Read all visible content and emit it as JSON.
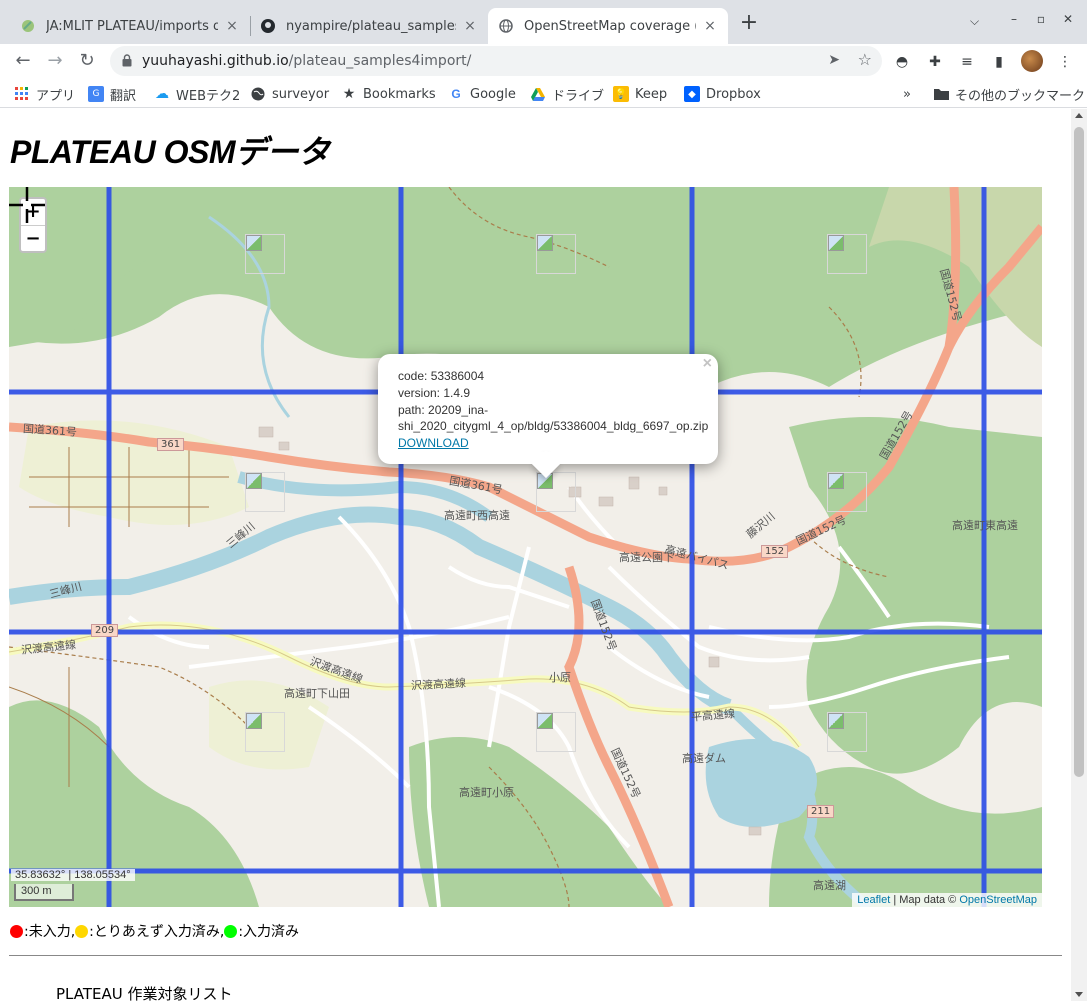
{
  "tabs": [
    {
      "title": "JA:MLIT PLATEAU/imports out",
      "icon": "osm-wiki-icon"
    },
    {
      "title": "nyampire/plateau_samples4im",
      "icon": "github-icon"
    },
    {
      "title": "OpenStreetMap coverage (am",
      "icon": "globe-icon"
    }
  ],
  "address": {
    "host": "yuuhayashi.github.io",
    "path": "/plateau_samples4import/"
  },
  "bookmarks": [
    {
      "label": "アプリ",
      "icon": "apps-grid-icon"
    },
    {
      "label": "翻訳",
      "icon": "translate-icon"
    },
    {
      "label": "WEBテク2",
      "icon": "cloud-icon"
    },
    {
      "label": "surveyor",
      "icon": "globe-icon"
    },
    {
      "label": "Bookmarks",
      "icon": "star-icon"
    },
    {
      "label": "Google",
      "icon": "google-icon"
    },
    {
      "label": "ドライブ",
      "icon": "drive-icon"
    },
    {
      "label": "Keep",
      "icon": "keep-icon"
    },
    {
      "label": "Dropbox",
      "icon": "dropbox-icon"
    }
  ],
  "bookmarks_more": "»",
  "other_bookmarks": "その他のブックマーク",
  "page": {
    "title": "PLATEAU OSMデータ",
    "zoom_in": "+",
    "zoom_out": "−",
    "popup": {
      "code": "code: 53386004",
      "version": "version: 1.4.9",
      "path1": "path: 20209_ina-",
      "path2": "shi_2020_citygml_4_op/bldg/53386004_bldg_6697_op.zip",
      "link": "DOWNLOAD",
      "close": "×"
    },
    "coords": "35.83632° | 138.05534°",
    "scale": "300 m",
    "attribution": {
      "leaflet": "Leaflet",
      "sep": " | Map data © ",
      "osm": "OpenStreetMap"
    },
    "map_labels": {
      "r361_a": "国道361号",
      "r361_b": "国道361号",
      "r152_a": "国道152号",
      "r152_b": "国道152号",
      "r152_c": "国道152号",
      "r152_d": "国道152号",
      "r152_e": "国道152号",
      "nishi": "高遠町西高遠",
      "higashi": "高遠町東高遠",
      "shimoyamada": "高遠町下山田",
      "obara_town": "高遠町小原",
      "obara": "小原",
      "sawatari": "沢渡高遠線",
      "sawatari2": "沢渡高遠線",
      "sawatari3": "沢渡高遠線",
      "bypass": "高遠公園下",
      "bypass2": "高遠バイパス",
      "dam": "高遠ダム",
      "ko": "高遠湖",
      "fujisawa": "藤沢川",
      "mibu": "三峰川",
      "mibu2": "三峰川",
      "heiko": "平高遠線",
      "shield361": "361",
      "shield152": "152",
      "shield211": "211",
      "shield209": "209"
    },
    "legend": [
      {
        "color": "#ff0000",
        "label": ":未入力, "
      },
      {
        "color": "#ffd700",
        "label": ":とりあえず入力済み, "
      },
      {
        "color": "#00ff00",
        "label": ":入力済み"
      }
    ],
    "list_heading": "PLATEAU 作業対象リスト"
  },
  "colors": {
    "grid": "#2e4fe6",
    "road_primary": "#f4a68a",
    "forest": "#add19e",
    "water": "#aad3df"
  }
}
